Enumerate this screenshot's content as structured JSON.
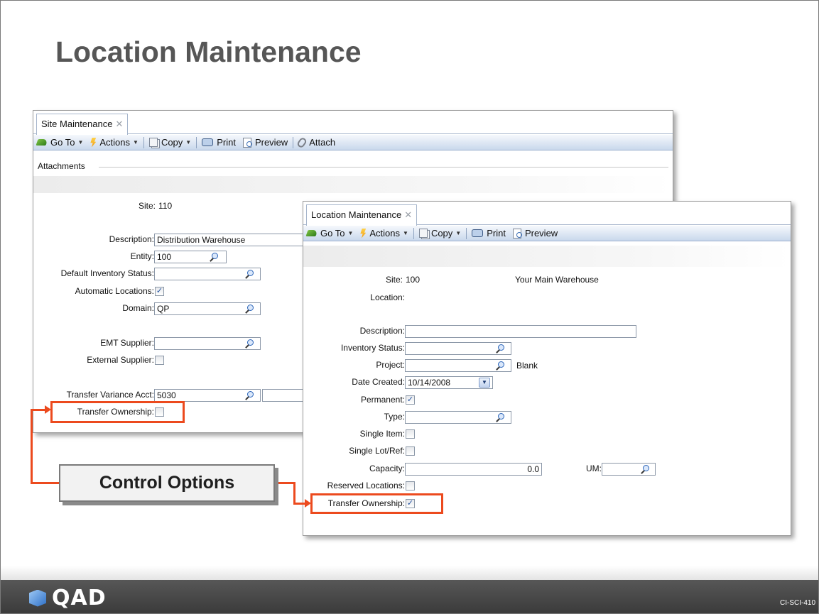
{
  "slide": {
    "title": "Location Maintenance",
    "callout": "Control Options",
    "footer_logo": "QAD",
    "footer_code": "CI-SCI-410"
  },
  "toolbar": {
    "goto": "Go To",
    "actions": "Actions",
    "copy": "Copy",
    "print": "Print",
    "preview": "Preview",
    "attach": "Attach"
  },
  "site_window": {
    "tab_title": "Site Maintenance",
    "section": "Attachments",
    "site_label": "Site:",
    "site_value": "110",
    "description_label": "Description:",
    "description_value": "Distribution Warehouse",
    "entity_label": "Entity:",
    "entity_value": "100",
    "default_inv_status_label": "Default Inventory Status:",
    "default_inv_status_value": "",
    "auto_locations_label": "Automatic Locations:",
    "auto_locations_checked": true,
    "domain_label": "Domain:",
    "domain_value": "QP",
    "emt_supplier_label": "EMT Supplier:",
    "emt_supplier_value": "",
    "external_supplier_label": "External Supplier:",
    "external_supplier_checked": false,
    "transfer_var_acct_label": "Transfer Variance Acct:",
    "transfer_var_acct_value": "5030",
    "transfer_ownership_label": "Transfer Ownership:",
    "transfer_ownership_checked": false
  },
  "location_window": {
    "tab_title": "Location Maintenance",
    "site_label": "Site:",
    "site_value": "100",
    "site_desc": "Your Main Warehouse",
    "location_label": "Location:",
    "description_label": "Description:",
    "description_value": "",
    "inventory_status_label": "Inventory Status:",
    "inventory_status_value": "",
    "project_label": "Project:",
    "project_value": "",
    "project_desc": "Blank",
    "date_created_label": "Date Created:",
    "date_created_value": "10/14/2008",
    "permanent_label": "Permanent:",
    "permanent_checked": true,
    "type_label": "Type:",
    "type_value": "",
    "single_item_label": "Single Item:",
    "single_item_checked": false,
    "single_lot_label": "Single Lot/Ref:",
    "single_lot_checked": false,
    "capacity_label": "Capacity:",
    "capacity_value": "0.0",
    "um_label": "UM:",
    "um_value": "",
    "reserved_locations_label": "Reserved Locations:",
    "reserved_locations_checked": false,
    "transfer_ownership_label": "Transfer Ownership:",
    "transfer_ownership_checked": true
  },
  "colors": {
    "highlight": "#ec4a1e",
    "title_gray": "#565656",
    "toolbar_blue": "#c9d8ec"
  }
}
